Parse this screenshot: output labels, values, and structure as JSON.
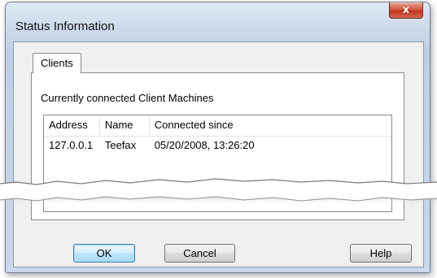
{
  "window": {
    "title": "Status Information",
    "close_glyph": "x"
  },
  "tabs": [
    {
      "label": "Clients",
      "selected": true
    }
  ],
  "panel": {
    "caption": "Currently connected Client Machines"
  },
  "list": {
    "columns": [
      "Address",
      "Name",
      "Connected since"
    ],
    "rows": [
      [
        "127.0.0.1",
        "Teefax",
        "05/20/2008, 13:26:20"
      ]
    ]
  },
  "buttons": {
    "ok": "OK",
    "cancel": "Cancel",
    "help": "Help"
  },
  "colors": {
    "accent": "#3c7fb1",
    "close": "#c2351c"
  }
}
